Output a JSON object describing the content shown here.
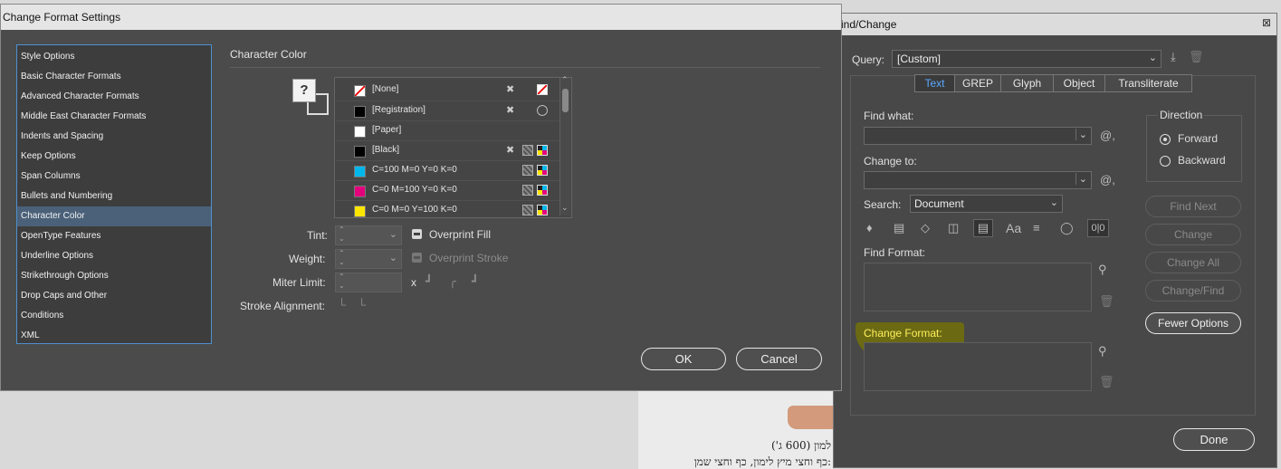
{
  "change_format": {
    "title": "Change Format Settings",
    "section_title": "Character Color",
    "categories": [
      "Style Options",
      "Basic Character Formats",
      "Advanced Character Formats",
      "Middle East Character Formats",
      "Indents and Spacing",
      "Keep Options",
      "Span Columns",
      "Bullets and Numbering",
      "Character Color",
      "OpenType Features",
      "Underline Options",
      "Strikethrough Options",
      "Drop Caps and Other",
      "Conditions",
      "XML"
    ],
    "swatches": [
      "[None]",
      "[Registration]",
      "[Paper]",
      "[Black]",
      "C=100 M=0 Y=0 K=0",
      "C=0 M=100 Y=0 K=0",
      "C=0 M=0 Y=100 K=0"
    ],
    "swatch_colors": [
      "#ffffff",
      "#000000",
      "#ffffff",
      "#000000",
      "#00b7eb",
      "#e4007c",
      "#ffe600"
    ],
    "labels": {
      "tint": "Tint:",
      "weight": "Weight:",
      "miter": "Miter Limit:",
      "stroke_align": "Stroke Alignment:",
      "x": "x"
    },
    "overprint_fill": "Overprint Fill",
    "overprint_stroke": "Overprint Stroke",
    "ok": "OK",
    "cancel": "Cancel"
  },
  "find_change": {
    "title": "ind/Change",
    "query_label": "Query:",
    "query_value": "[Custom]",
    "tabs": [
      "Text",
      "GREP",
      "Glyph",
      "Object",
      "Transliterate"
    ],
    "find_what": "Find what:",
    "change_to": "Change to:",
    "search_label": "Search:",
    "search_value": "Document",
    "find_format": "Find Format:",
    "change_format": "Change Format:",
    "direction": "Direction",
    "forward": "Forward",
    "backward": "Backward",
    "find_next": "Find Next",
    "change": "Change",
    "change_all": "Change All",
    "change_find": "Change/Find",
    "fewer_options": "Fewer Options",
    "done": "Done",
    "close": "⊠",
    "aa": "Aa"
  },
  "background_doc": {
    "line1": "למון (600 ג')",
    "line2": ":כף וחצי מיץ לימון, כף וחצי שמן"
  }
}
